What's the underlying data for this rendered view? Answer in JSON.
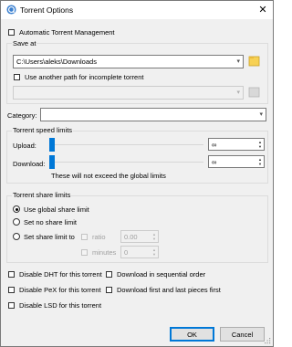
{
  "window": {
    "title": "Torrent Options",
    "close_glyph": "✕"
  },
  "automatic_management": {
    "label": "Automatic Torrent Management",
    "checked": false
  },
  "save_at": {
    "group_title": "Save at",
    "path": "C:\\Users\\aleks\\Downloads",
    "incomplete_label": "Use another path for incomplete torrent",
    "incomplete_checked": false,
    "incomplete_path": ""
  },
  "category": {
    "label": "Category:",
    "value": ""
  },
  "speed_limits": {
    "group_title": "Torrent speed limits",
    "upload_label": "Upload:",
    "upload_value": "∞",
    "download_label": "Download:",
    "download_value": "∞",
    "note": "These will not exceed the global limits"
  },
  "share_limits": {
    "group_title": "Torrent share limits",
    "options": [
      "Use global share limit",
      "Set no share limit",
      "Set share limit to"
    ],
    "selected": "Use global share limit",
    "ratio_label": "ratio",
    "ratio_value": "0.00",
    "minutes_label": "minutes",
    "minutes_value": "0"
  },
  "options": {
    "disable_dht": "Disable DHT for this torrent",
    "sequential": "Download in sequential order",
    "disable_pex": "Disable PeX for this torrent",
    "first_last": "Download first and last pieces first",
    "disable_lsd": "Disable LSD for this torrent"
  },
  "buttons": {
    "ok": "OK",
    "cancel": "Cancel"
  },
  "colors": {
    "accent": "#0078d7",
    "folder": "#f7d154",
    "window_bg": "#f0f0f0"
  }
}
